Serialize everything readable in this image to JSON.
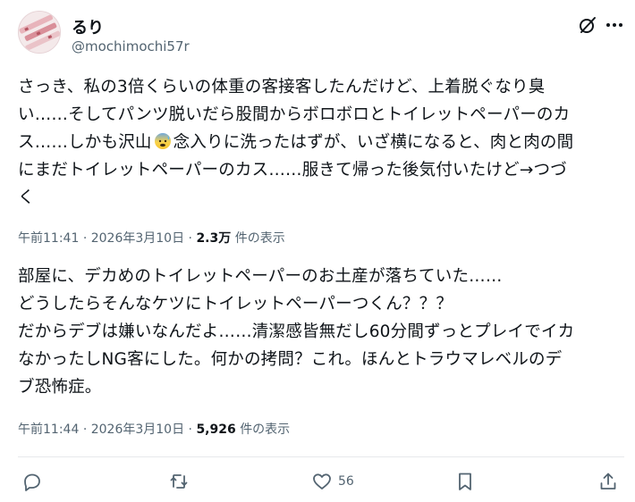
{
  "user": {
    "display_name": "るり",
    "handle": "@mochimochi57r"
  },
  "post1": {
    "lines": [
      "さっき、私の3倍くらいの体重の客接客したんだけど、上着脱ぐなり臭",
      "い……そしてパンツ脱いだら股間からボロボロとトイレットペーパーのカ",
      "ス……しかも沢山",
      "念入りに洗ったはずが、いざ横になると、肉と肉の間",
      "にまだトイレットペーパーのカス……服きて帰った後気付いたけど→つづ",
      "く"
    ],
    "emoji": "anxious-face-with-sweat-emoji",
    "time": "午前11:41",
    "date": "2026年3月10日",
    "views": "2.3万",
    "views_label": "件の表示"
  },
  "post2": {
    "lines": [
      "部屋に、デカめのトイレットペーパーのお土産が落ちていた……",
      "どうしたらそんなケツにトイレットペーパーつくん？？？",
      "だからデブは嫌いなんだよ……清潔感皆無だし60分間ずっとプレイでイカ",
      "なかったしNG客にした。何かの拷問？これ。ほんとトラウマレベルのデ",
      "ブ恐怖症。"
    ],
    "time": "午前11:44",
    "date": "2026年3月10日",
    "views": "5,926",
    "views_label": "件の表示"
  },
  "separator": "·",
  "actions": {
    "reply_count": "",
    "repost_count": "",
    "like_count": "56"
  },
  "colors": {
    "text": "#0f1419",
    "secondary": "#536471",
    "divider": "#e7e9eb"
  }
}
